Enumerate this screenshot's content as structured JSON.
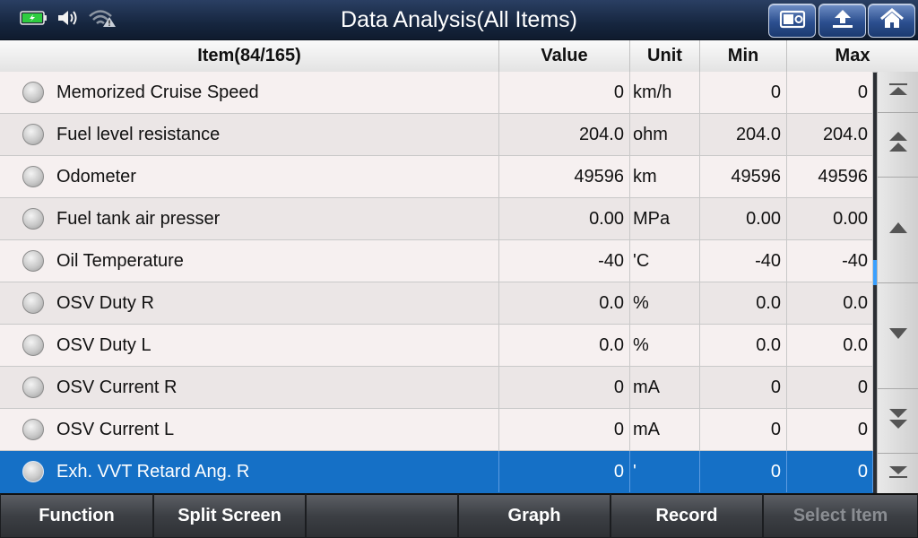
{
  "header": {
    "title": "Data Analysis(All Items)"
  },
  "table": {
    "columns": {
      "item": "Item(84/165)",
      "value": "Value",
      "unit": "Unit",
      "min": "Min",
      "max": "Max"
    },
    "rows": [
      {
        "name": "Memorized Cruise Speed",
        "value": "0",
        "unit": "km/h",
        "min": "0",
        "max": "0"
      },
      {
        "name": "Fuel level resistance",
        "value": "204.0",
        "unit": "ohm",
        "min": "204.0",
        "max": "204.0"
      },
      {
        "name": "Odometer",
        "value": "49596",
        "unit": "km",
        "min": "49596",
        "max": "49596"
      },
      {
        "name": "Fuel tank air presser",
        "value": "0.00",
        "unit": "MPa",
        "min": "0.00",
        "max": "0.00"
      },
      {
        "name": "Oil Temperature",
        "value": "-40",
        "unit": "'C",
        "min": "-40",
        "max": "-40"
      },
      {
        "name": "OSV Duty R",
        "value": "0.0",
        "unit": "%",
        "min": "0.0",
        "max": "0.0"
      },
      {
        "name": "OSV Duty L",
        "value": "0.0",
        "unit": "%",
        "min": "0.0",
        "max": "0.0"
      },
      {
        "name": "OSV Current R",
        "value": "0",
        "unit": "mA",
        "min": "0",
        "max": "0"
      },
      {
        "name": "OSV Current L",
        "value": "0",
        "unit": "mA",
        "min": "0",
        "max": "0"
      },
      {
        "name": "Exh. VVT Retard Ang. R",
        "value": "0",
        "unit": "'",
        "min": "0",
        "max": "0"
      }
    ],
    "selected_row": 9
  },
  "toolbar": {
    "function": "Function",
    "split_screen": "Split Screen",
    "empty": "",
    "graph": "Graph",
    "record": "Record",
    "select_item": "Select Item"
  },
  "colors": {
    "selected_row": "#1570c6",
    "battery": "#2ecc40",
    "title_bar": "#16263f"
  },
  "icons": [
    "battery-icon",
    "speaker-icon",
    "wifi-warning-icon",
    "screenshot-icon",
    "back-icon",
    "home-icon"
  ]
}
